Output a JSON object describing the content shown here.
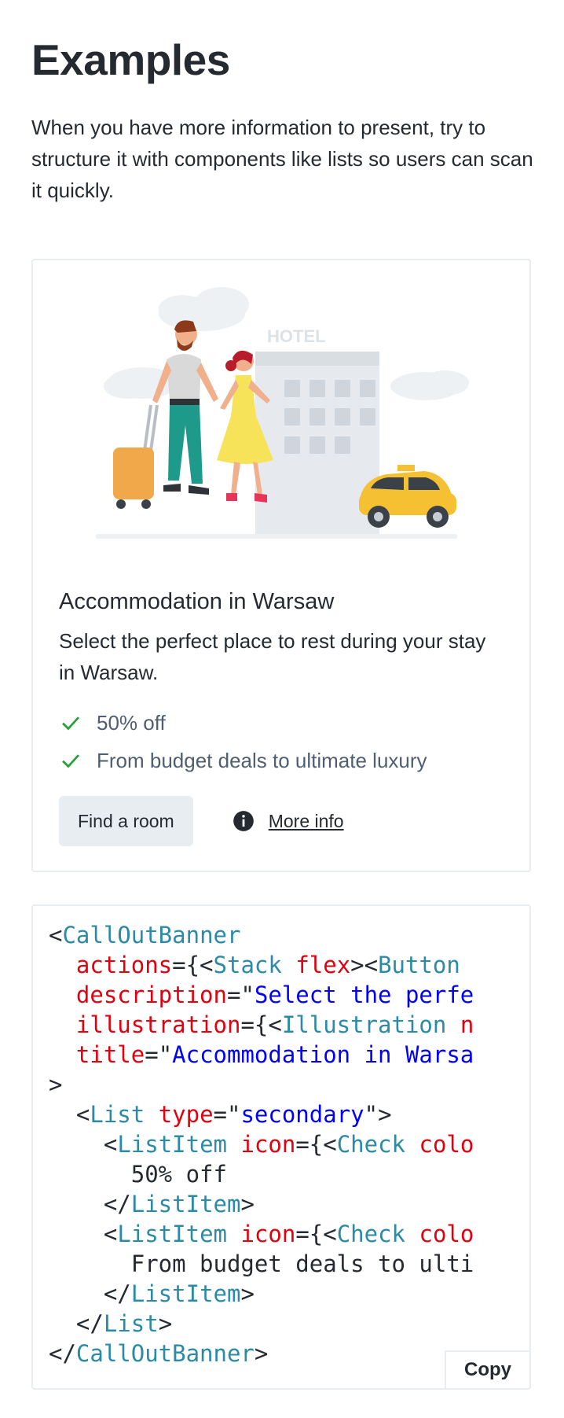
{
  "section": {
    "heading": "Examples",
    "intro": "When you have more information to present, try to structure it with components like lists so users can scan it quickly."
  },
  "banner": {
    "illustration_icon": "hotel-couple-illustration",
    "illustration_sign": "HOTEL",
    "title": "Accommodation in Warsaw",
    "description": "Select the perfect place to rest during your stay in Warsaw.",
    "list": [
      {
        "icon": "check-icon",
        "text": "50% off"
      },
      {
        "icon": "check-icon",
        "text": "From budget deals to ultimate luxury"
      }
    ],
    "primary_action": "Find a room",
    "secondary_action": "More info",
    "secondary_icon": "info-icon",
    "colors": {
      "check": "#28a138",
      "border": "#e8edf1",
      "button_bg": "#e8edf1",
      "muted_text": "#4f5e71"
    }
  },
  "code": {
    "lines": [
      [
        [
          "p",
          "<"
        ],
        [
          "t",
          "CallOutBanner"
        ]
      ],
      [
        [
          "p",
          "  "
        ],
        [
          "a",
          "actions"
        ],
        [
          "p",
          "={<"
        ],
        [
          "t",
          "Stack"
        ],
        [
          "p",
          " "
        ],
        [
          "a",
          "flex"
        ],
        [
          "p",
          "><"
        ],
        [
          "t",
          "Button"
        ]
      ],
      [
        [
          "p",
          "  "
        ],
        [
          "a",
          "description"
        ],
        [
          "p",
          "=\""
        ],
        [
          "s",
          "Select the perfe"
        ]
      ],
      [
        [
          "p",
          "  "
        ],
        [
          "a",
          "illustration"
        ],
        [
          "p",
          "={<"
        ],
        [
          "t",
          "Illustration"
        ],
        [
          "p",
          " "
        ],
        [
          "a",
          "n"
        ]
      ],
      [
        [
          "p",
          "  "
        ],
        [
          "a",
          "title"
        ],
        [
          "p",
          "=\""
        ],
        [
          "s",
          "Accommodation in Warsa"
        ]
      ],
      [
        [
          "p",
          ">"
        ]
      ],
      [
        [
          "p",
          "  <"
        ],
        [
          "t",
          "List"
        ],
        [
          "p",
          " "
        ],
        [
          "a",
          "type"
        ],
        [
          "p",
          "=\""
        ],
        [
          "s",
          "secondary"
        ],
        [
          "p",
          "\">"
        ]
      ],
      [
        [
          "p",
          "    <"
        ],
        [
          "t",
          "ListItem"
        ],
        [
          "p",
          " "
        ],
        [
          "a",
          "icon"
        ],
        [
          "p",
          "={<"
        ],
        [
          "t",
          "Check"
        ],
        [
          "p",
          " "
        ],
        [
          "a",
          "colo"
        ]
      ],
      [
        [
          "p",
          "      50% off"
        ]
      ],
      [
        [
          "p",
          "    </"
        ],
        [
          "t",
          "ListItem"
        ],
        [
          "p",
          ">"
        ]
      ],
      [
        [
          "p",
          "    <"
        ],
        [
          "t",
          "ListItem"
        ],
        [
          "p",
          " "
        ],
        [
          "a",
          "icon"
        ],
        [
          "p",
          "={<"
        ],
        [
          "t",
          "Check"
        ],
        [
          "p",
          " "
        ],
        [
          "a",
          "colo"
        ]
      ],
      [
        [
          "p",
          "      From budget deals to ulti"
        ]
      ],
      [
        [
          "p",
          "    </"
        ],
        [
          "t",
          "ListItem"
        ],
        [
          "p",
          ">"
        ]
      ],
      [
        [
          "p",
          "  </"
        ],
        [
          "t",
          "List"
        ],
        [
          "p",
          ">"
        ]
      ],
      [
        [
          "p",
          "</"
        ],
        [
          "t",
          "CallOutBanner"
        ],
        [
          "p",
          ">"
        ]
      ]
    ],
    "copy_label": "Copy"
  }
}
